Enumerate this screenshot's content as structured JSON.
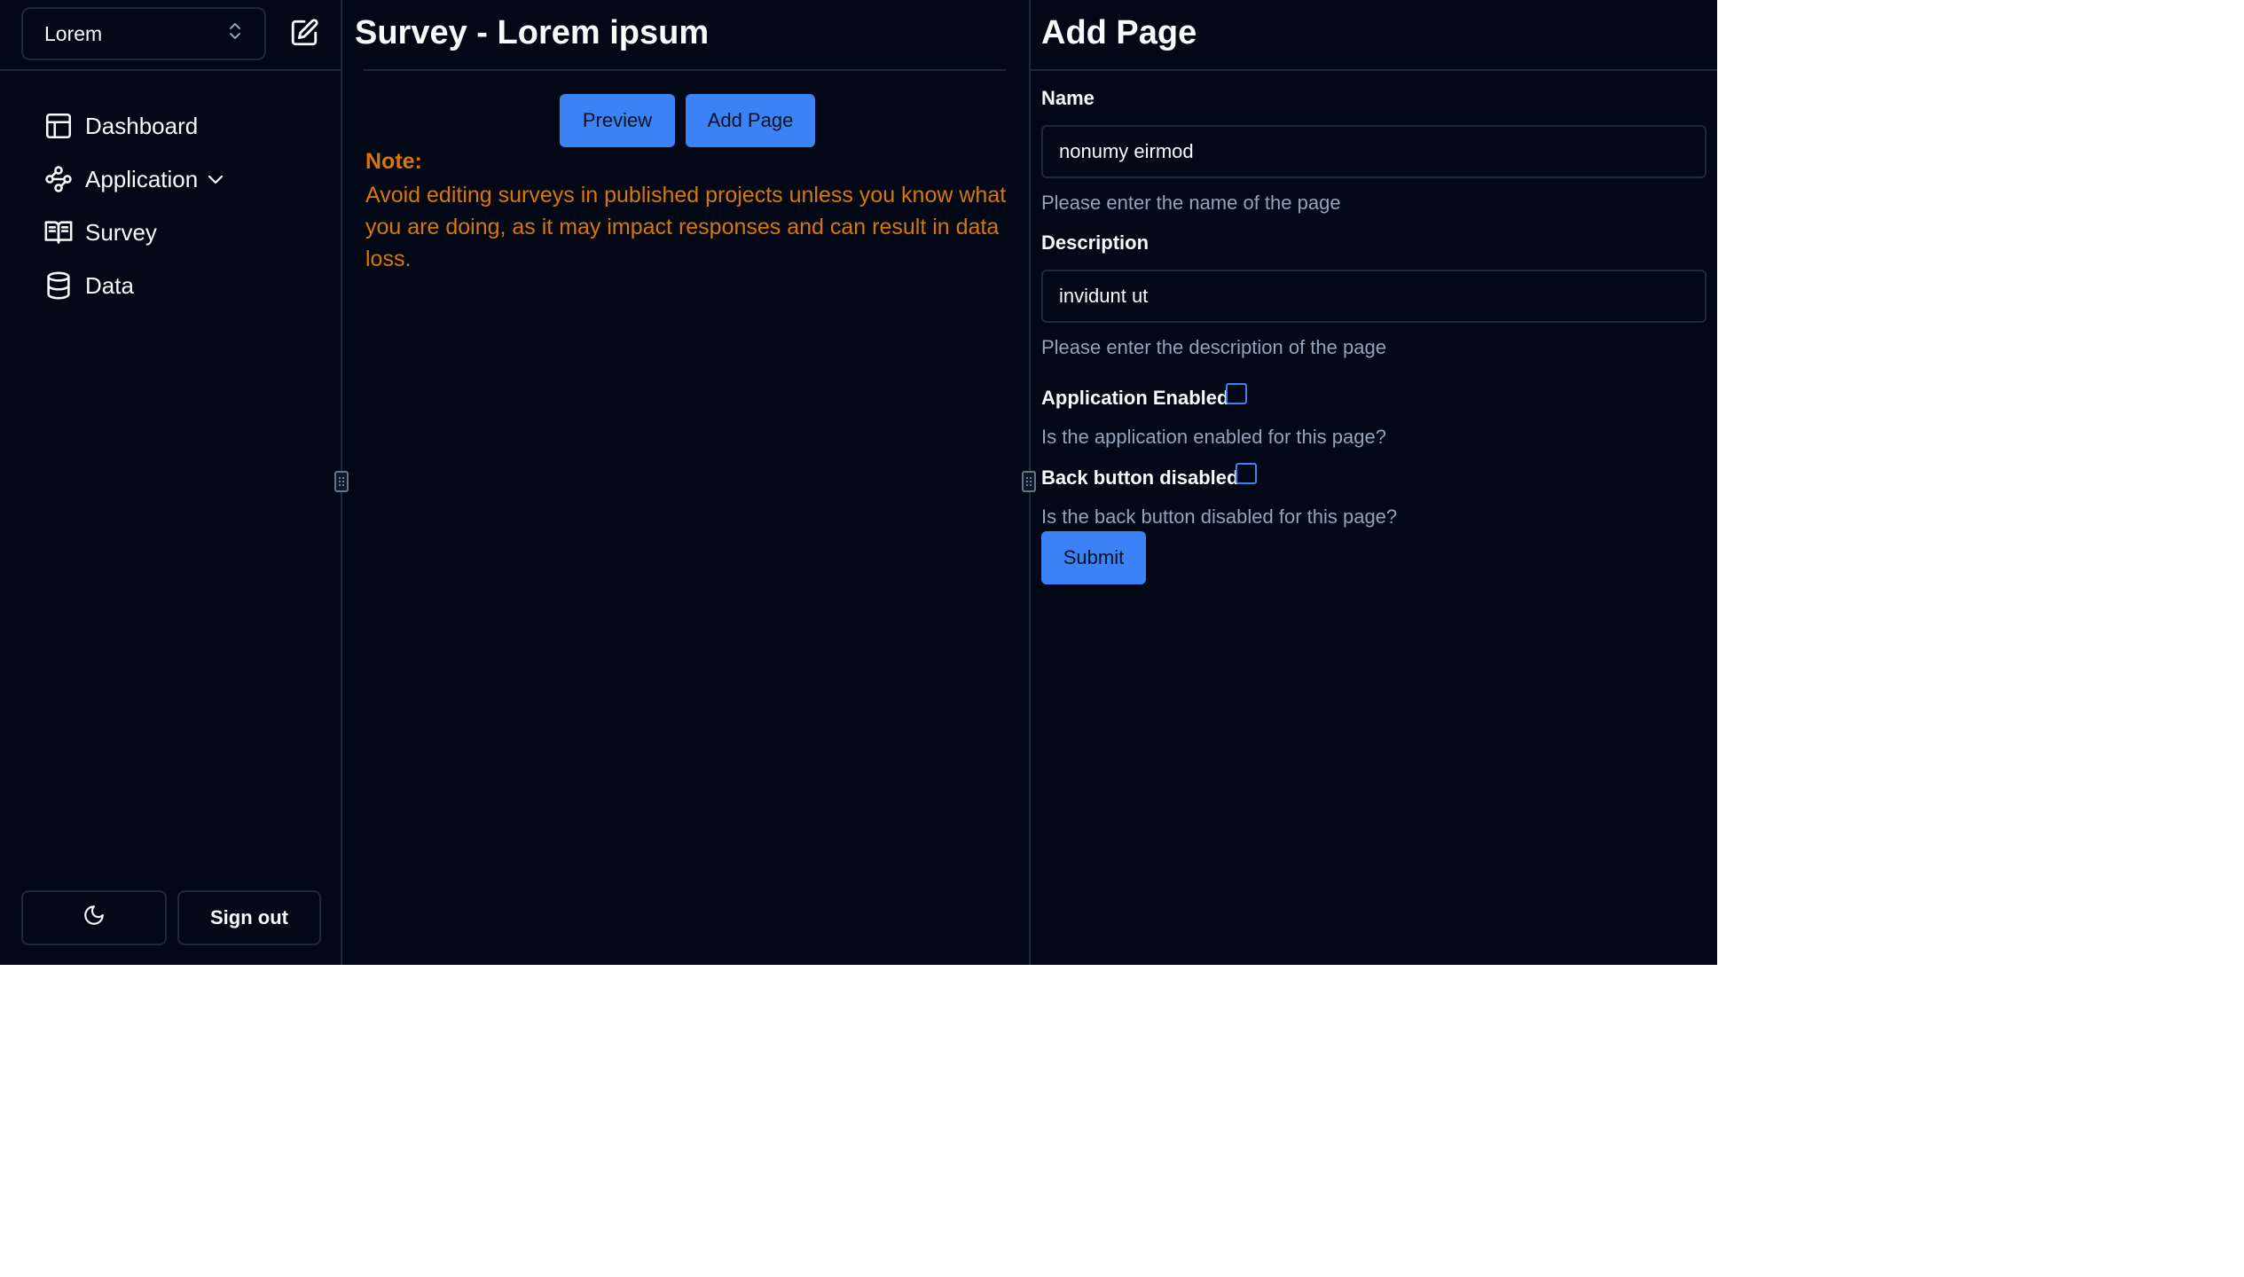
{
  "sidebar": {
    "project_select": {
      "value": "Lorem",
      "icon": "chevrons-up-down-icon"
    },
    "edit_icon": "pencil-square-icon",
    "nav": [
      {
        "label": "Dashboard",
        "icon": "layout-icon"
      },
      {
        "label": "Application",
        "icon": "workflow-icon",
        "expand_icon": "chevron-down-icon"
      },
      {
        "label": "Survey",
        "icon": "book-open-icon"
      },
      {
        "label": "Data",
        "icon": "database-icon"
      }
    ],
    "theme_toggle_icon": "moon-icon",
    "sign_out_label": "Sign out"
  },
  "middle": {
    "title": "Survey - Lorem ipsum",
    "preview_label": "Preview",
    "add_page_label": "Add Page",
    "note_title": "Note:",
    "note_text": "Avoid editing surveys in published projects unless you know what you are doing, as it may impact responses and can result in data loss."
  },
  "right": {
    "title": "Add Page",
    "name_label": "Name",
    "name_value": "nonumy eirmod",
    "name_help": "Please enter the name of the page",
    "description_label": "Description",
    "description_value": "invidunt ut",
    "description_help": "Please enter the description of the page",
    "application_enabled_label": "Application Enabled",
    "application_enabled_checked": false,
    "application_enabled_help": "Is the application enabled for this page?",
    "back_button_label": "Back button disabled",
    "back_button_checked": false,
    "back_button_help": "Is the back button disabled for this page?",
    "submit_label": "Submit"
  },
  "colors": {
    "background": "#030817",
    "border": "#1e293b",
    "primary": "#3b82f6",
    "warning": "#d97706",
    "muted_text": "#94a3b8"
  }
}
